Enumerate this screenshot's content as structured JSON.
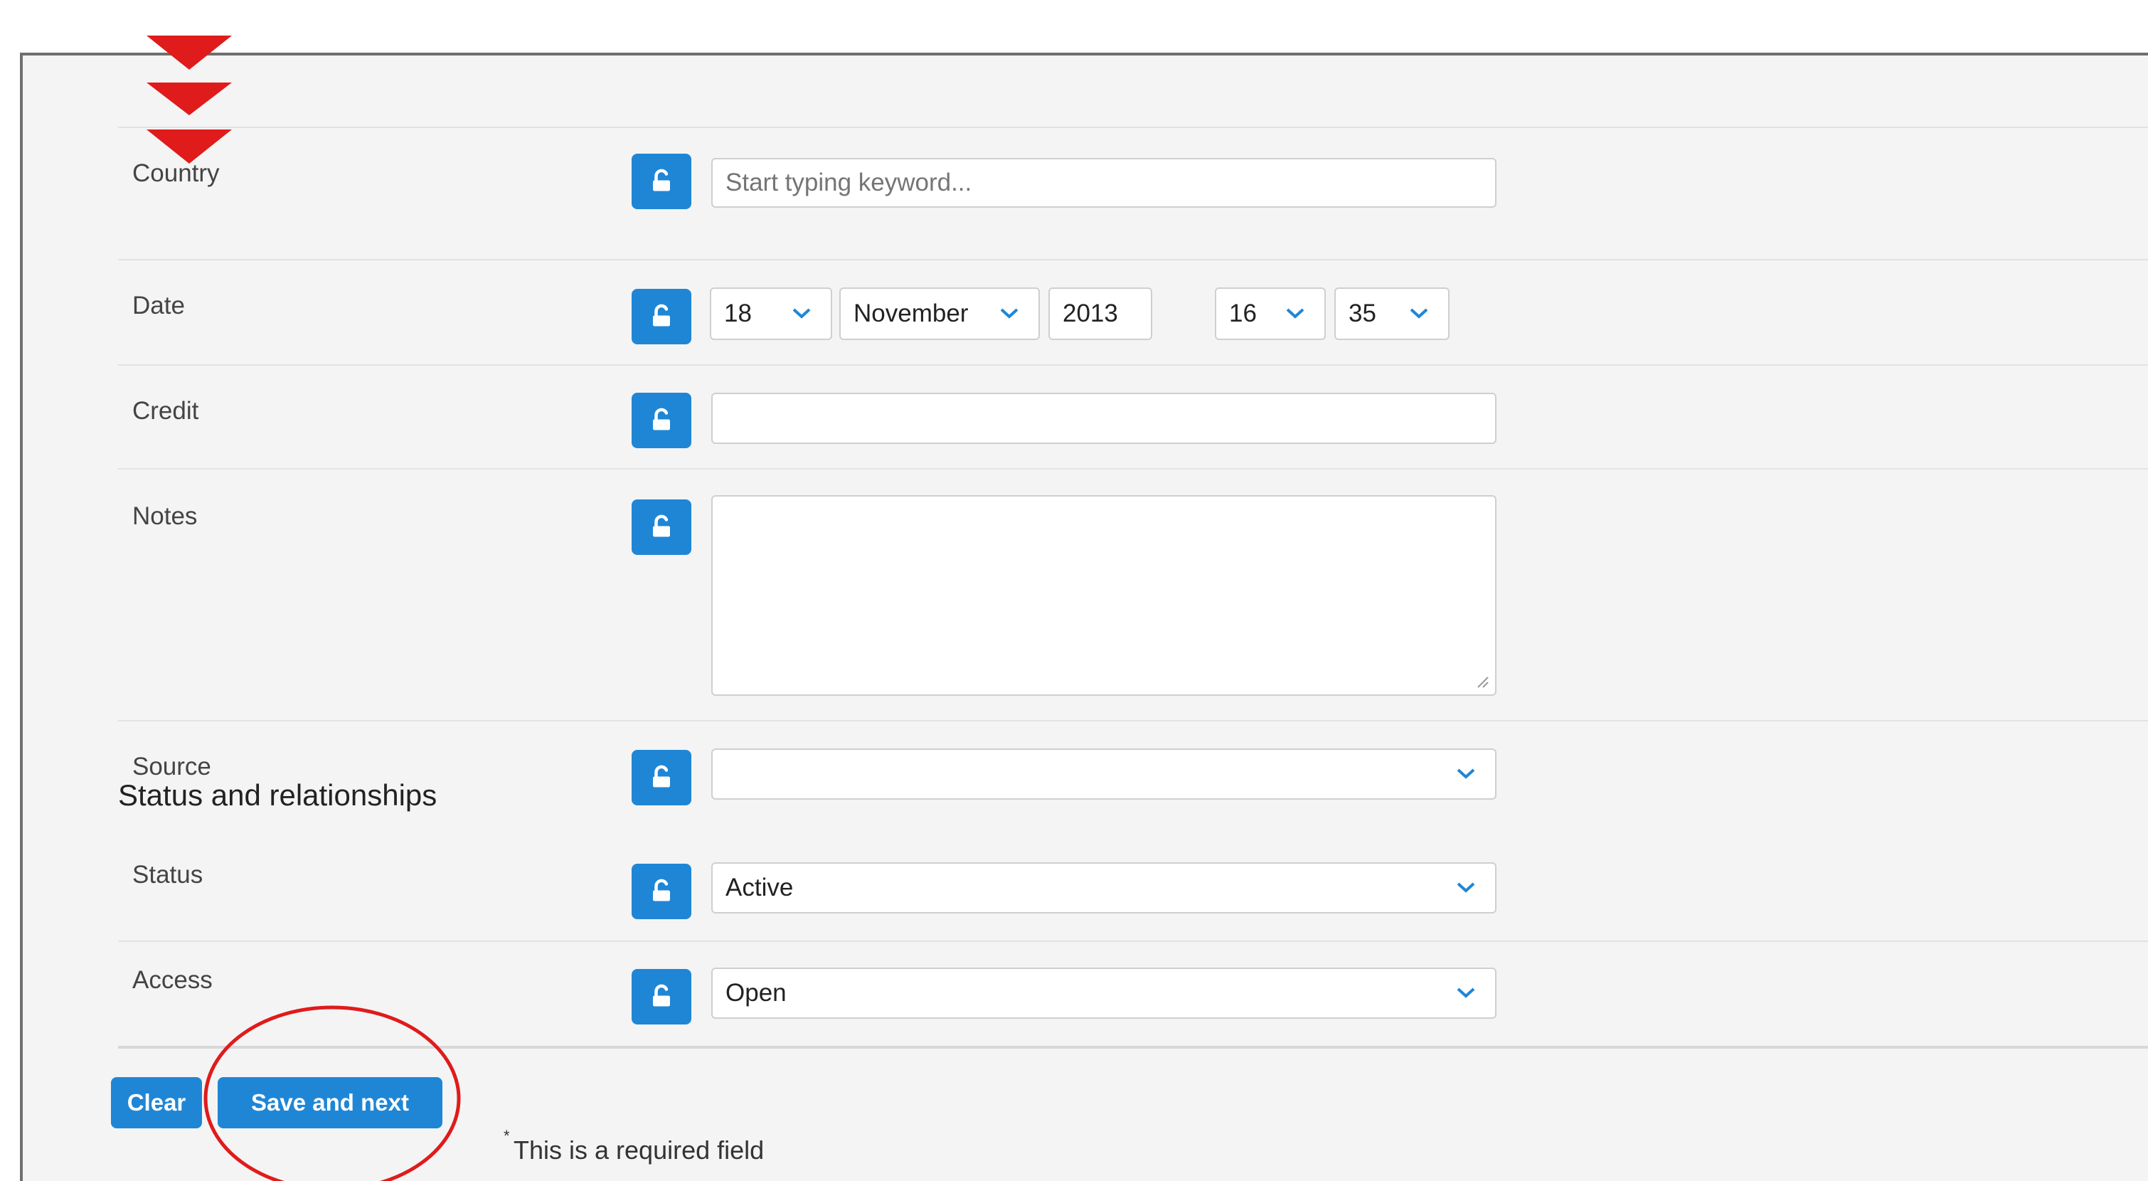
{
  "fields": {
    "country": {
      "label": "Country",
      "placeholder": "Start typing keyword..."
    },
    "date": {
      "label": "Date",
      "day": "18",
      "month": "November",
      "year": "2013",
      "hour": "16",
      "minute": "35"
    },
    "credit": {
      "label": "Credit",
      "value": ""
    },
    "notes": {
      "label": "Notes",
      "value": ""
    },
    "source": {
      "label": "Source",
      "value": ""
    }
  },
  "section": {
    "title": "Status and relationships"
  },
  "status": {
    "label": "Status",
    "value": "Active"
  },
  "access": {
    "label": "Access",
    "value": "Open"
  },
  "footer": {
    "clear_label": "Clear",
    "save_next_label": "Save and next",
    "required_star": "*",
    "required_note": "This is a required field"
  },
  "colors": {
    "accent": "#1f86d6",
    "annotation": "#e01b1b",
    "panel_bg": "#f4f4f4"
  },
  "icons": {
    "lock": "unlock-icon",
    "chevron": "chevron-down-icon"
  }
}
